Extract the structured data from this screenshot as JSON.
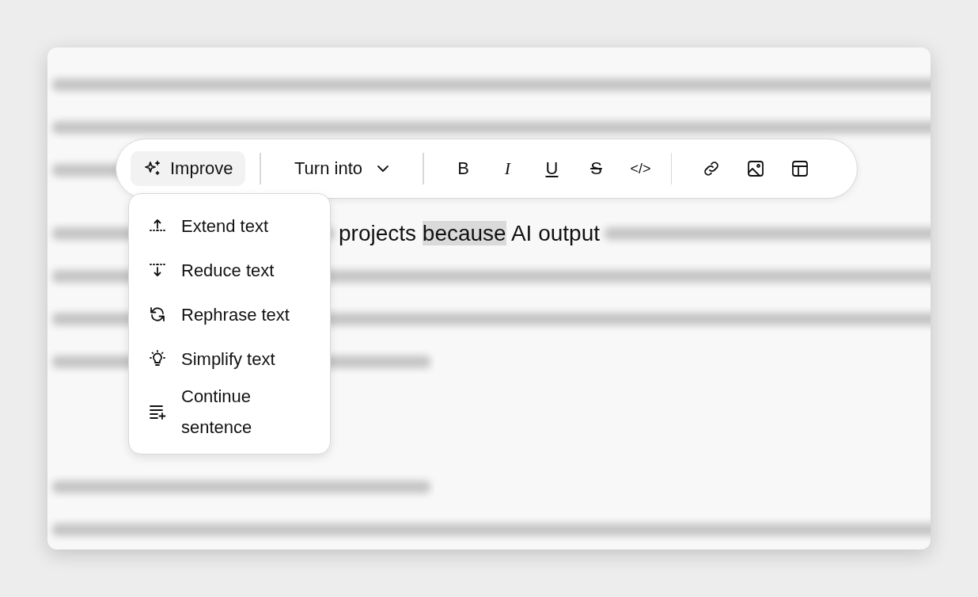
{
  "toolbar": {
    "improve": "Improve",
    "turn_into": "Turn into",
    "format_buttons": [
      {
        "label": "B",
        "kind": "bold"
      },
      {
        "label": "I",
        "kind": "italic"
      },
      {
        "label": "U",
        "kind": "underline"
      },
      {
        "label": "S",
        "kind": "strikethrough"
      },
      {
        "label": "</>",
        "kind": "code"
      }
    ],
    "insert_buttons": [
      {
        "kind": "link"
      },
      {
        "kind": "image"
      },
      {
        "kind": "table"
      }
    ]
  },
  "menu": {
    "items": [
      {
        "label": "Extend text",
        "kind": "extend"
      },
      {
        "label": "Reduce text",
        "kind": "reduce"
      },
      {
        "label": "Rephrase text",
        "kind": "rephrase"
      },
      {
        "label": "Simplify text",
        "kind": "simplify"
      },
      {
        "label": "Continue sentence",
        "kind": "continue"
      }
    ]
  },
  "editor": {
    "visible_text": [
      {
        "text": "projects ",
        "selected": false
      },
      {
        "text": "because",
        "selected": true
      },
      {
        "text": " AI output",
        "selected": false
      }
    ]
  }
}
